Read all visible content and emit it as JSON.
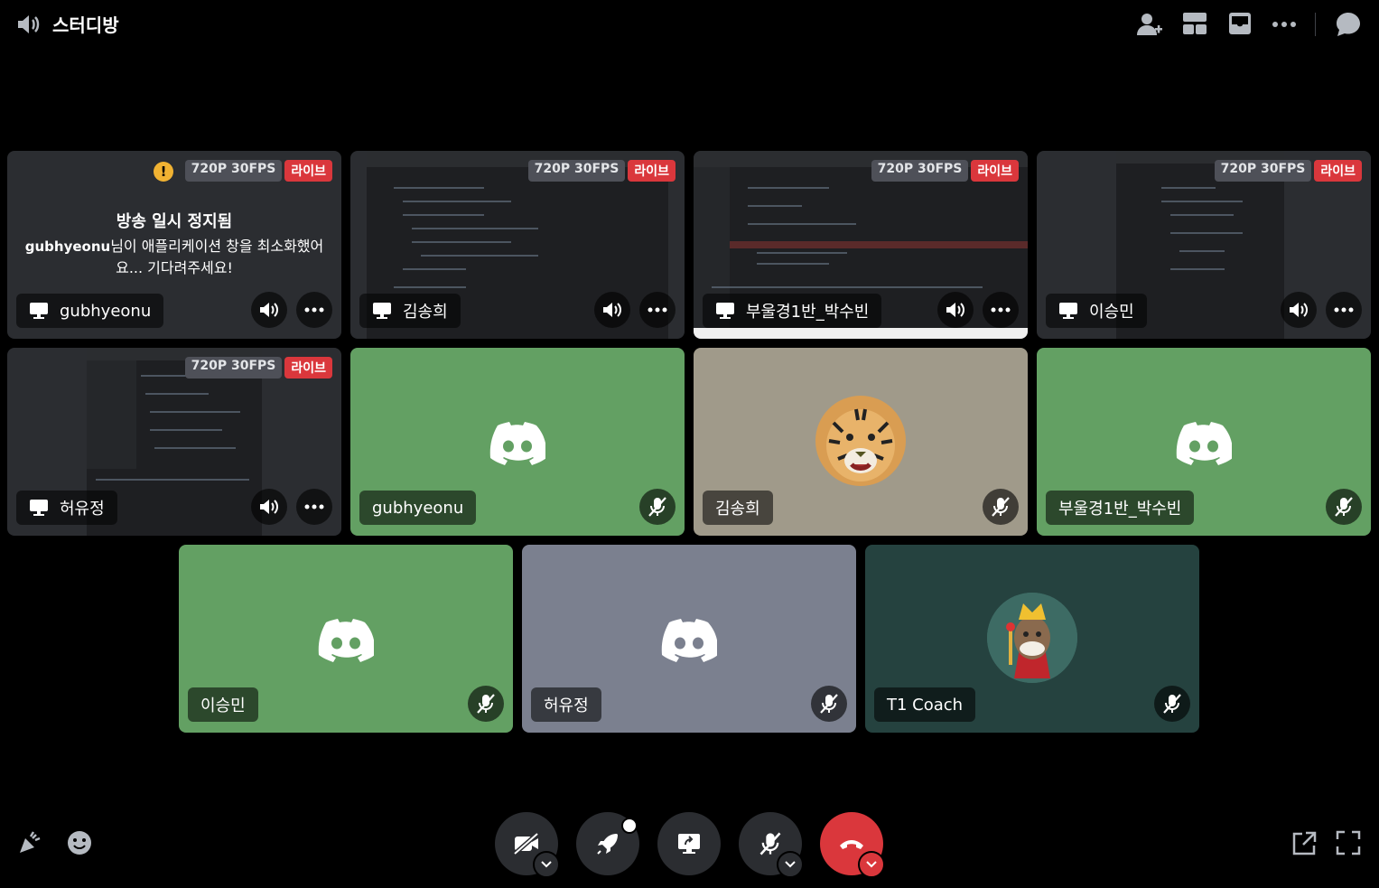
{
  "channel": {
    "title": "스터디방"
  },
  "colors": {
    "green_tile": "#63a063",
    "tan_tile": "#a09a8a",
    "grey_tile": "#7b808f",
    "teal_tile": "#25423f",
    "live_red": "#da373c"
  },
  "streams": [
    {
      "user": "gubhyeonu",
      "quality": "720P 30FPS",
      "live": "라이브",
      "paused_title": "방송 일시 정지됨",
      "paused_user": "gubhyeonu",
      "paused_msg": "님이 애플리케이션 창을 최소화했어요... 기다려주세요!"
    },
    {
      "user": "김송희",
      "quality": "720P 30FPS",
      "live": "라이브"
    },
    {
      "user": "부울경1반_박수빈",
      "quality": "720P 30FPS",
      "live": "라이브"
    },
    {
      "user": "이승민",
      "quality": "720P 30FPS",
      "live": "라이브"
    },
    {
      "user": "허유정",
      "quality": "720P 30FPS",
      "live": "라이브"
    }
  ],
  "participants": [
    {
      "name": "gubhyeonu",
      "avatar": "discord-logo",
      "muted": true
    },
    {
      "name": "김송희",
      "avatar": "tiger-avatar",
      "muted": true
    },
    {
      "name": "부울경1반_박수빈",
      "avatar": "discord-logo",
      "muted": true
    },
    {
      "name": "이승민",
      "avatar": "discord-logo",
      "muted": true
    },
    {
      "name": "허유정",
      "avatar": "discord-logo",
      "muted": true
    },
    {
      "name": "T1 Coach",
      "avatar": "mushroom-king-avatar",
      "muted": true
    }
  ],
  "icons": {
    "top": [
      "add-friend-icon",
      "grid-layout-icon",
      "inbox-icon",
      "more-icon",
      "chat-icon"
    ],
    "bottom_left": [
      "soundboard-icon",
      "emoji-icon"
    ],
    "controls": [
      "camera-off-icon",
      "activity-rocket-icon",
      "share-screen-icon",
      "mic-muted-icon",
      "hang-up-icon"
    ],
    "bottom_right": [
      "pop-out-icon",
      "fullscreen-icon"
    ]
  }
}
